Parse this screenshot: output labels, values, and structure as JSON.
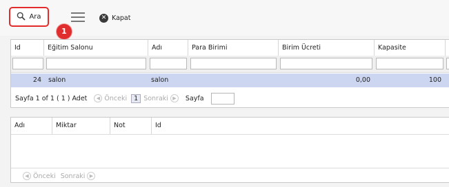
{
  "toolbar": {
    "search_label": "Ara",
    "close_label": "Kapat",
    "badge": "1"
  },
  "grid1": {
    "columns": [
      "Id",
      "Eğitim Salonu",
      "Adı",
      "Para Birimi",
      "Birim Ücreti",
      "Kapasite"
    ],
    "rows": [
      {
        "id": "24",
        "salon": "salon",
        "adi": "salon",
        "para_birimi": "",
        "birim_ucreti": "0,00",
        "kapasite": "100"
      }
    ],
    "pager": {
      "info": "Sayfa 1 of 1 ( 1 ) Adet",
      "prev": "Önceki",
      "page": "1",
      "next": "Sonraki",
      "page_label": "Sayfa"
    }
  },
  "grid2": {
    "columns": [
      "Adı",
      "Miktar",
      "Not",
      "Id"
    ],
    "pager": {
      "prev": "Önceki",
      "next": "Sonraki"
    }
  },
  "colors": {
    "highlight_border": "#e32b2b",
    "badge": "#e02d2d",
    "selected_row": "#ccd6f0"
  }
}
